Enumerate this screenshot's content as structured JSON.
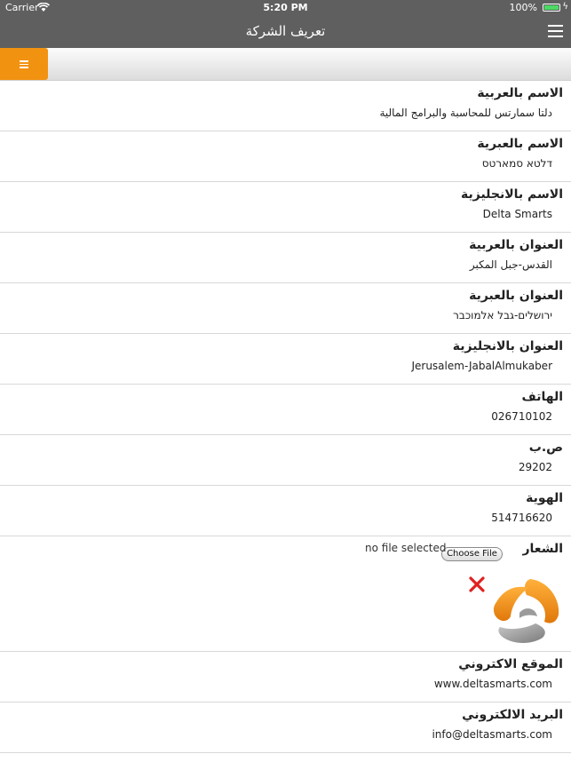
{
  "status_bar": {
    "carrier": "Carrier",
    "time": "5:20 PM",
    "battery": "100%"
  },
  "nav": {
    "title": "تعريف الشركة"
  },
  "fields": [
    {
      "label": "الاسم بالعربية",
      "value": "دلتا سمارتس للمحاسبة والبرامج المالية"
    },
    {
      "label": "الاسم بالعبرية",
      "value": "דלטא סמארטס"
    },
    {
      "label": "الاسم بالانجليزية",
      "value": "Delta Smarts"
    },
    {
      "label": "العنوان بالعربية",
      "value": "القدس-جبل المكبر"
    },
    {
      "label": "العنوان بالعبرية",
      "value": "ירושלים-גבל אלמוכבר"
    },
    {
      "label": "العنوان بالانجليزية",
      "value": "Jerusalem-JabalAlmukaber"
    },
    {
      "label": "الهاتف",
      "value": "026710102"
    },
    {
      "label": "ص.ب",
      "value": "29202"
    },
    {
      "label": "الهوية",
      "value": "514716620"
    }
  ],
  "logo": {
    "label": "الشعار",
    "choose_file": "Choose File",
    "file_status": "no file selected"
  },
  "contact_fields": [
    {
      "label": "الموقع الاكتروني",
      "value": "www.deltasmarts.com"
    },
    {
      "label": "البريد الالكتروني",
      "value": "info@deltasmarts.com"
    }
  ],
  "colors": {
    "bar": "#5f5f5f",
    "accent": "#f29211",
    "delete": "#e02020",
    "battery": "#4cd964"
  },
  "icons": [
    "wifi-icon",
    "battery-icon",
    "hamburger-menu-icon",
    "menu-lines-icon",
    "delete-icon",
    "company-logo"
  ]
}
